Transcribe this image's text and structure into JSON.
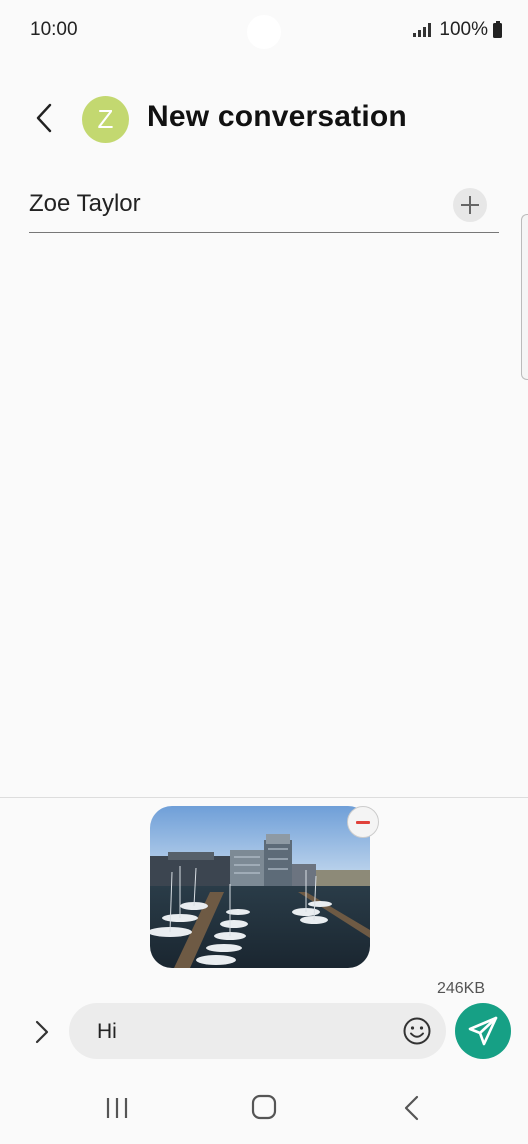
{
  "status_bar": {
    "time": "10:00",
    "battery": "100%",
    "icons": [
      "signal-icon",
      "battery-icon"
    ]
  },
  "header": {
    "back_icon": "chevron-left-icon",
    "avatar_letter": "Z",
    "avatar_color": "#c3d870",
    "title": "New conversation"
  },
  "recipient": {
    "name": "Zoe Taylor",
    "add_icon": "plus-icon"
  },
  "attachment": {
    "size": "246KB",
    "remove_icon": "minus-icon"
  },
  "composer": {
    "expand_icon": "chevron-right-icon",
    "message": "Hi",
    "emoji_icon": "smiley-icon",
    "send_icon": "send-icon",
    "send_color": "#16a085"
  },
  "nav_bar": {
    "icons": [
      "recent-apps-icon",
      "home-icon",
      "back-icon"
    ]
  }
}
